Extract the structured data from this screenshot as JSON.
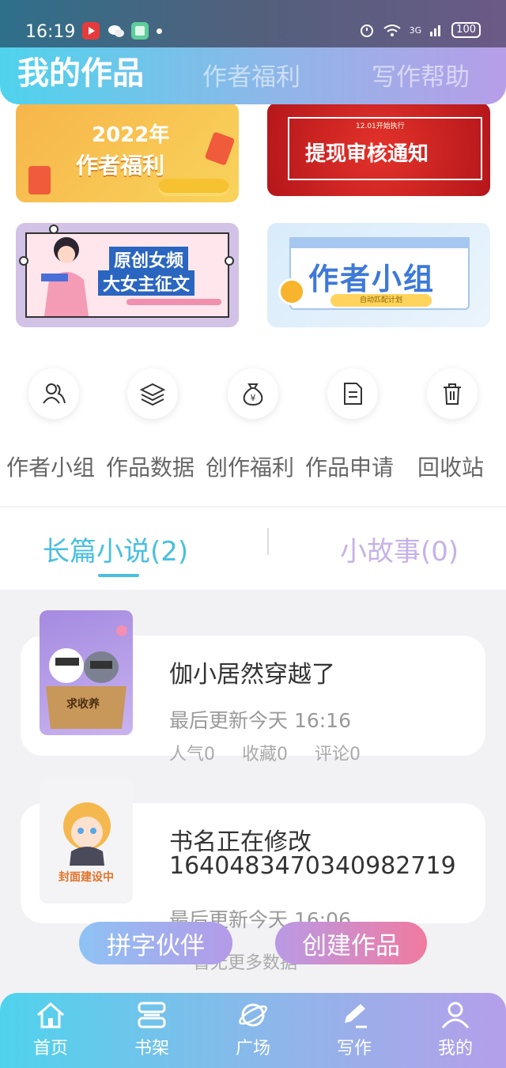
{
  "status_bar": {
    "time": "16:19",
    "battery": "100",
    "network": "3G"
  },
  "top_tabs": {
    "mine": "我的作品",
    "welfare": "作者福利",
    "help": "写作帮助"
  },
  "banners": {
    "welfare": {
      "year": "2022年",
      "title": "作者福利"
    },
    "withdraw": {
      "small": "12.01开始执行",
      "title": "提现审核通知"
    },
    "contest": {
      "line1": "原创女频",
      "line2": "大女主征文"
    },
    "group": {
      "title": "作者小组",
      "pill": "自动匹配计划"
    }
  },
  "quick_actions": [
    {
      "label": "作者小组",
      "icon": "users-icon"
    },
    {
      "label": "作品数据",
      "icon": "layers-icon"
    },
    {
      "label": "创作福利",
      "icon": "money-bag-icon"
    },
    {
      "label": "作品申请",
      "icon": "document-icon"
    },
    {
      "label": "回收站",
      "icon": "trash-icon"
    }
  ],
  "segments": {
    "long": "长篇小说(2)",
    "short": "小故事(0)"
  },
  "works": [
    {
      "title": "伽小居然穿越了",
      "updated": "最后更新今天 16:16",
      "popularity": "人气0",
      "favorites": "收藏0",
      "comments": "评论0",
      "cover_text": "求收养"
    },
    {
      "title": "书名正在修改",
      "title2": "1640483470340982719",
      "updated": "最后更新今天 16:06",
      "cover_text": "封面建设中"
    }
  ],
  "floating": {
    "partner": "拼字伙伴",
    "create": "创建作品"
  },
  "more_text": "暂无更多数据",
  "bottom_nav": [
    {
      "label": "首页",
      "icon": "home-icon"
    },
    {
      "label": "书架",
      "icon": "bookshelf-icon"
    },
    {
      "label": "广场",
      "icon": "planet-icon"
    },
    {
      "label": "写作",
      "icon": "pen-icon"
    },
    {
      "label": "我的",
      "icon": "user-icon"
    }
  ],
  "colors": {
    "accent": "#49bfe0",
    "purple": "#c6b2e6"
  }
}
